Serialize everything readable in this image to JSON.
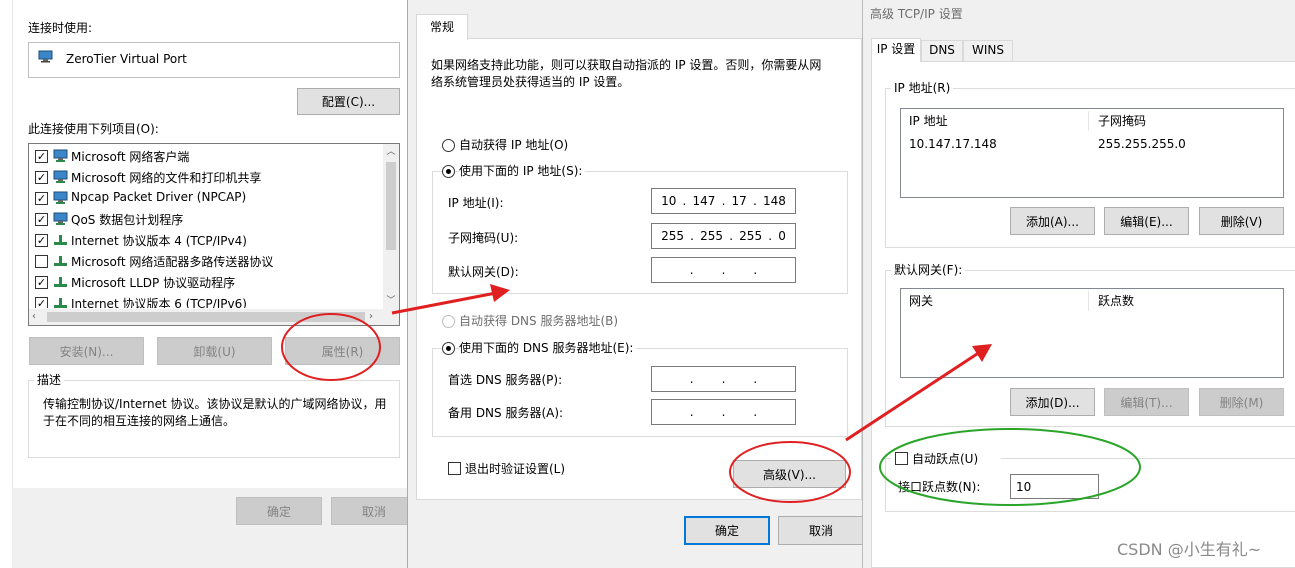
{
  "left_dialog": {
    "connect_using_label": "连接时使用:",
    "adapter_name": "ZeroTier Virtual Port",
    "configure_button": "配置(C)...",
    "items_label": "此连接使用下列项目(O):",
    "items": [
      {
        "label": "Microsoft 网络客户端",
        "checked": true,
        "icon": "network-client-icon"
      },
      {
        "label": "Microsoft 网络的文件和打印机共享",
        "checked": true,
        "icon": "network-share-icon"
      },
      {
        "label": "Npcap Packet Driver (NPCAP)",
        "checked": true,
        "icon": "network-driver-icon"
      },
      {
        "label": "QoS 数据包计划程序",
        "checked": true,
        "icon": "network-service-icon"
      },
      {
        "label": "Internet 协议版本 4 (TCP/IPv4)",
        "checked": true,
        "icon": "protocol-icon"
      },
      {
        "label": "Microsoft 网络适配器多路传送器协议",
        "checked": false,
        "icon": "protocol-icon"
      },
      {
        "label": "Microsoft LLDP 协议驱动程序",
        "checked": true,
        "icon": "protocol-icon"
      },
      {
        "label": "Internet 协议版本 6 (TCP/IPv6)",
        "checked": true,
        "icon": "protocol-icon"
      }
    ],
    "install_button": "安装(N)...",
    "uninstall_button": "卸载(U)",
    "properties_button": "属性(R)",
    "description_label": "描述",
    "description_text": "传输控制协议/Internet 协议。该协议是默认的广域网络协议，用于在不同的相互连接的网络上通信。",
    "description_line1": "传输控制协议/Internet 协议。该协议是默认的广域网络协议，用",
    "description_line2": "于在不同的相互连接的网络上通信。",
    "ok_button": "确定",
    "cancel_button": "取消"
  },
  "middle_dialog": {
    "tab_general": "常规",
    "intro_line1": "如果网络支持此功能，则可以获取自动指派的 IP 设置。否则，你需要从网",
    "intro_line2": "络系统管理员处获得适当的 IP 设置。",
    "auto_ip_label": "自动获得 IP 地址(O)",
    "use_ip_label": "使用下面的 IP 地址(S):",
    "ip_address_label": "IP 地址(I):",
    "ip_address_value": [
      "10",
      "147",
      "17",
      "148"
    ],
    "subnet_label": "子网掩码(U):",
    "subnet_value": [
      "255",
      "255",
      "255",
      "0"
    ],
    "gateway_label": "默认网关(D):",
    "gateway_value": [
      "",
      "",
      "",
      ""
    ],
    "auto_dns_label": "自动获得 DNS 服务器地址(B)",
    "use_dns_label": "使用下面的 DNS 服务器地址(E):",
    "preferred_dns_label": "首选 DNS 服务器(P):",
    "alternate_dns_label": "备用 DNS 服务器(A):",
    "validate_label": "退出时验证设置(L)",
    "validate_checked": false,
    "advanced_button": "高级(V)...",
    "ok_button": "确定",
    "cancel_button": "取消"
  },
  "right_dialog": {
    "title": "高级 TCP/IP 设置",
    "tabs": [
      "IP 设置",
      "DNS",
      "WINS"
    ],
    "ip_group_label": "IP 地址(R)",
    "ip_table_headers": [
      "IP 地址",
      "子网掩码"
    ],
    "ip_table_rows": [
      [
        "10.147.17.148",
        "255.255.255.0"
      ]
    ],
    "ip_add_button": "添加(A)...",
    "ip_edit_button": "编辑(E)...",
    "ip_delete_button": "删除(V)",
    "gateway_group_label": "默认网关(F):",
    "gateway_table_headers": [
      "网关",
      "跃点数"
    ],
    "gw_add_button": "添加(D)...",
    "gw_edit_button": "编辑(T)...",
    "gw_delete_button": "删除(M)",
    "auto_metric_label": "自动跃点(U)",
    "auto_metric_checked": false,
    "interface_metric_label": "接口跃点数(N):",
    "interface_metric_value": "10"
  },
  "watermark": "CSDN @小生有礼~",
  "colors": {
    "annotation_red": "#e02020",
    "annotation_green": "#2aa52a",
    "focus_blue": "#0078d7"
  }
}
